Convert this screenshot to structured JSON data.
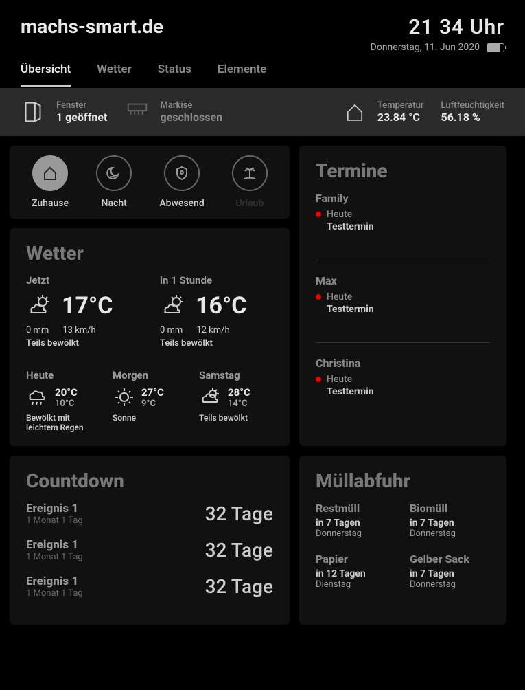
{
  "site_title": "machs-smart.de",
  "time": "21 34 Uhr",
  "date": "Donnerstag, 11. Jun 2020",
  "tabs": [
    "Übersicht",
    "Wetter",
    "Status",
    "Elemente"
  ],
  "status": {
    "fenster": {
      "label": "Fenster",
      "value": "1 geöffnet"
    },
    "markise": {
      "label": "Markise",
      "value": "geschlossen"
    },
    "temperatur": {
      "label": "Temperatur",
      "value": "23.84 °C"
    },
    "luftfeuchtigkeit": {
      "label": "Luftfeuchtigkeit",
      "value": "56.18 %"
    }
  },
  "modes": [
    "Zuhause",
    "Nacht",
    "Abwesend",
    "Urlaub"
  ],
  "wetter": {
    "title": "Wetter",
    "now": {
      "label": "Jetzt",
      "temp": "17°C",
      "precip": "0 mm",
      "wind": "13 km/h",
      "desc": "Teils bewölkt"
    },
    "soon": {
      "label": "in 1 Stunde",
      "temp": "16°C",
      "precip": "0 mm",
      "wind": "12 km/h",
      "desc": "Teils bewölkt"
    },
    "forecast": [
      {
        "label": "Heute",
        "hi": "20°C",
        "lo": "10°C",
        "desc": "Bewölkt mit leichtem Regen"
      },
      {
        "label": "Morgen",
        "hi": "27°C",
        "lo": "9°C",
        "desc": "Sonne"
      },
      {
        "label": "Samstag",
        "hi": "28°C",
        "lo": "14°C",
        "desc": "Teils bewölkt"
      }
    ]
  },
  "termine": {
    "title": "Termine",
    "groups": [
      {
        "name": "Family",
        "when": "Heute",
        "what": "Testtermin"
      },
      {
        "name": "Max",
        "when": "Heute",
        "what": "Testtermin"
      },
      {
        "name": "Christina",
        "when": "Heute",
        "what": "Testtermin"
      }
    ]
  },
  "countdown": {
    "title": "Countdown",
    "items": [
      {
        "name": "Ereignis 1",
        "sub": "1 Monat 1 Tag",
        "days": "32 Tage"
      },
      {
        "name": "Ereignis 1",
        "sub": "1 Monat 1 Tag",
        "days": "32 Tage"
      },
      {
        "name": "Ereignis 1",
        "sub": "1 Monat 1 Tag",
        "days": "32 Tage"
      }
    ]
  },
  "muell": {
    "title": "Müllabfuhr",
    "items": [
      {
        "name": "Restmüll",
        "when": "in 7 Tagen",
        "day": "Donnerstag"
      },
      {
        "name": "Biomüll",
        "when": "in 7 Tagen",
        "day": "Donnerstag"
      },
      {
        "name": "Papier",
        "when": "in 12 Tagen",
        "day": "Dienstag"
      },
      {
        "name": "Gelber Sack",
        "when": "in 7 Tagen",
        "day": "Donnerstag"
      }
    ]
  }
}
